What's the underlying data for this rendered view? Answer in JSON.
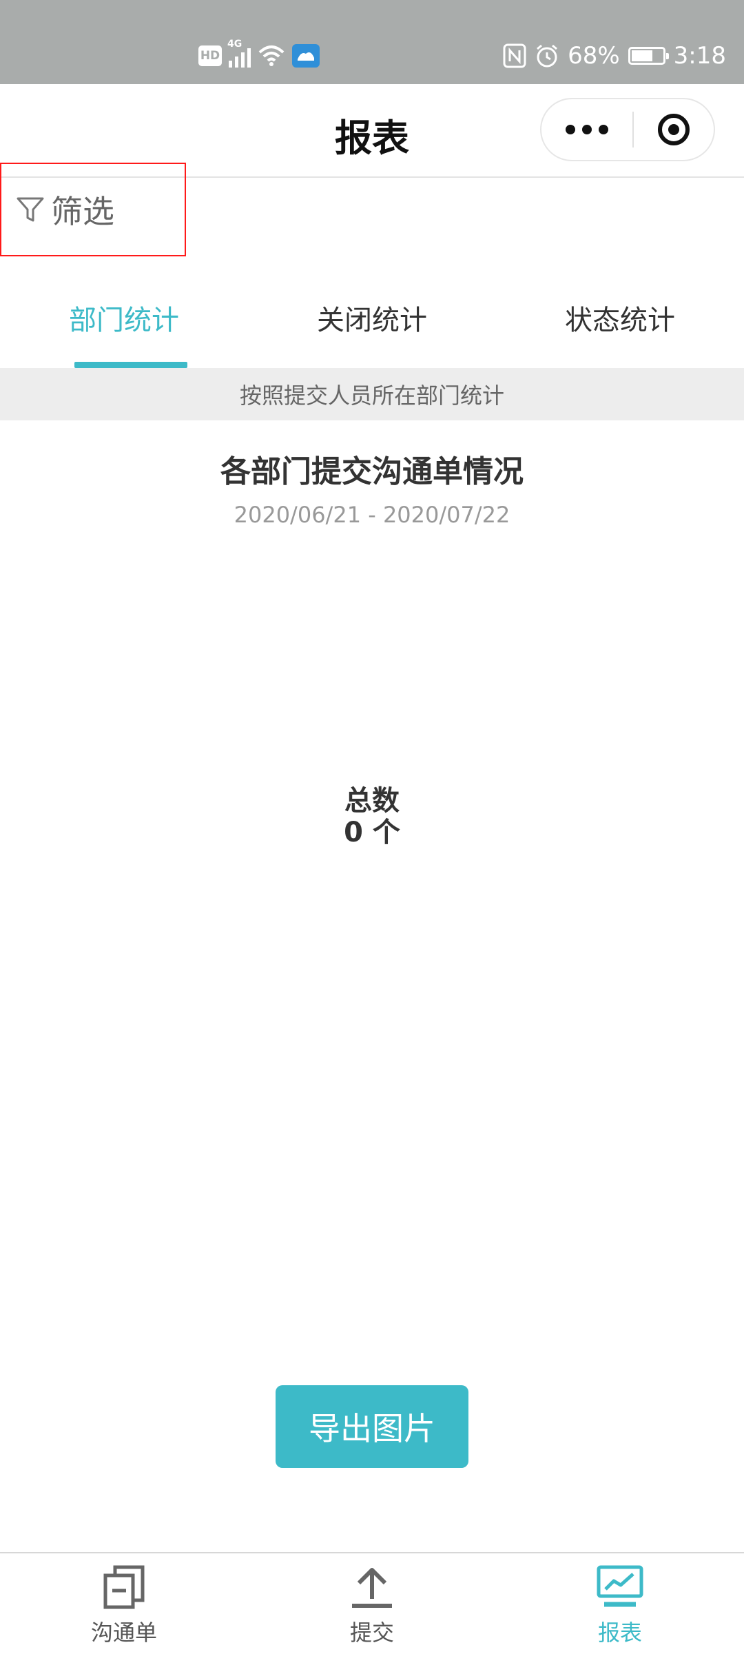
{
  "status_bar": {
    "network": "4G",
    "hd": "HD",
    "battery_percent": "68%",
    "battery_level": 0.68,
    "time": "3:18"
  },
  "nav": {
    "title": "报表"
  },
  "filter": {
    "label": "筛选"
  },
  "tabs": [
    {
      "label": "部门统计",
      "active": true
    },
    {
      "label": "关闭统计",
      "active": false
    },
    {
      "label": "状态统计",
      "active": false
    }
  ],
  "section": {
    "subtitle": "按照提交人员所在部门统计"
  },
  "chart_data": {
    "type": "pie",
    "title": "各部门提交沟通单情况",
    "subtitle": "2020/06/21 - 2020/07/22",
    "center_label": "总数",
    "center_value": "0 个",
    "categories": [],
    "values": []
  },
  "actions": {
    "export_label": "导出图片"
  },
  "tabbar": {
    "items": [
      {
        "label": "沟通单",
        "icon": "document-icon",
        "active": false
      },
      {
        "label": "提交",
        "icon": "upload-icon",
        "active": false
      },
      {
        "label": "报表",
        "icon": "chart-icon",
        "active": true
      }
    ]
  },
  "colors": {
    "accent": "#3dbac8",
    "status_bar": "#a9acab",
    "highlight_border": "#ff1a1a"
  }
}
